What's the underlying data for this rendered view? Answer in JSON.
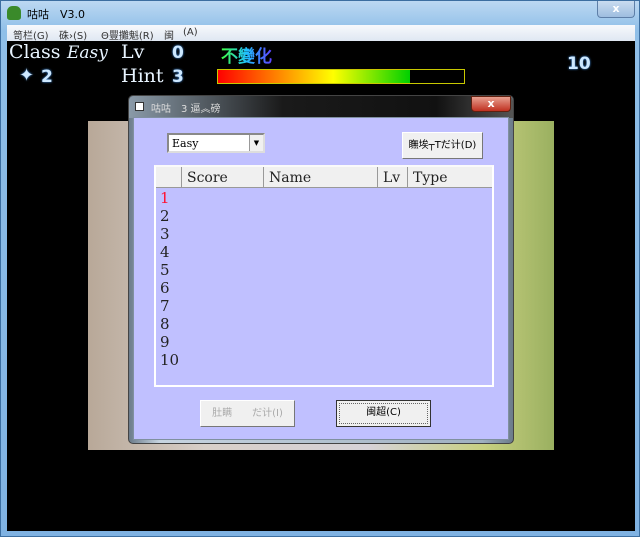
{
  "window": {
    "title": "咕咕　V3.0",
    "close": "x"
  },
  "menu": [
    "笥栏(G)",
    "硃›(S)",
    "Θ豐攤魁(R)",
    "闽",
    "(A)"
  ],
  "hud": {
    "class_label": "Class",
    "class_value": "Easy",
    "lv_label": "Lv",
    "lv_value": "0",
    "status": "不變化",
    "lives": "2",
    "hint_label": "Hint",
    "hint_value": "3",
    "right_number": "10",
    "energy_fraction": 0.78
  },
  "dialog": {
    "title": "咕咕　3 逼︽磅",
    "close": "x",
    "difficulty": "Easy",
    "top_button": "瞴埃┬Tだ计(D)",
    "columns": [
      "",
      "Score",
      "Name",
      "Lv",
      "Type"
    ],
    "ranks": [
      "1",
      "2",
      "3",
      "4",
      "5",
      "6",
      "7",
      "8",
      "9",
      "10"
    ],
    "left_button": "肚瞒　　だ计(I)",
    "close_button": "闽超(C)"
  }
}
